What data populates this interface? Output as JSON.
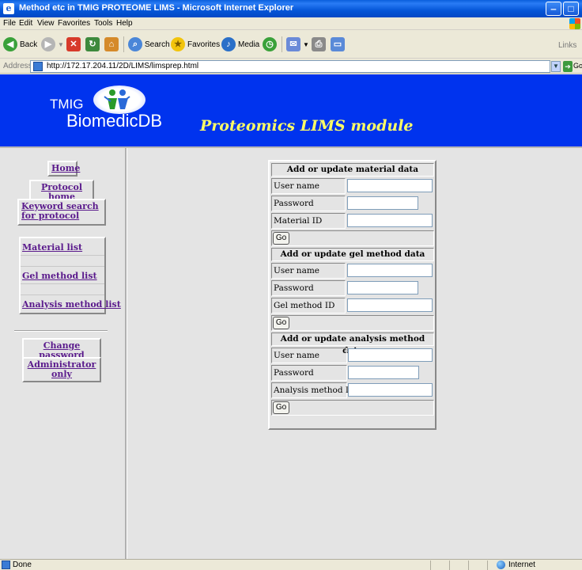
{
  "window": {
    "title": "Method etc in TMIG PROTEOME LIMS - Microsoft Internet Explorer",
    "minimize": "‒",
    "maximize": "□",
    "close": "✕"
  },
  "menu": [
    "File",
    "Edit",
    "View",
    "Favorites",
    "Tools",
    "Help"
  ],
  "toolbar": {
    "back": "Back",
    "search": "Search",
    "favorites": "Favorites",
    "media": "Media",
    "links": "Links"
  },
  "address": {
    "label": "Address",
    "url": "http://172.17.204.11/2D/LIMS/limsprep.html",
    "go": "Go"
  },
  "banner": {
    "logo_top": "TMIG",
    "logo_bottom": "BiomedicDB",
    "title": "Proteomics LIMS module"
  },
  "nav": {
    "home": "Home",
    "protocol_home": "Protocol home",
    "keyword_search": "Keyword search for protocol",
    "material_list": "Material list",
    "gel_method_list": "Gel method list",
    "analysis_method_list": "Analysis method list",
    "change_password": "Change password",
    "administrator_only": "Administrator only"
  },
  "forms": {
    "material": {
      "header": "Add or update material data",
      "user_name": "User name",
      "password": "Password",
      "id_label": "Material ID",
      "go": "Go"
    },
    "gel": {
      "header": "Add or update gel method data",
      "user_name": "User name",
      "password": "Password",
      "id_label": "Gel method ID",
      "go": "Go"
    },
    "analysis": {
      "header": "Add or update analysis method data",
      "user_name": "User name",
      "password": "Password",
      "id_label": "Analysis method ID",
      "go": "Go"
    }
  },
  "status": {
    "left": "Done",
    "zone": "Internet"
  },
  "colors": {
    "banner_bg": "#0033ee",
    "banner_title": "#ffff66",
    "link": "#5a1a8c",
    "content_bg": "#e4e4e4"
  }
}
